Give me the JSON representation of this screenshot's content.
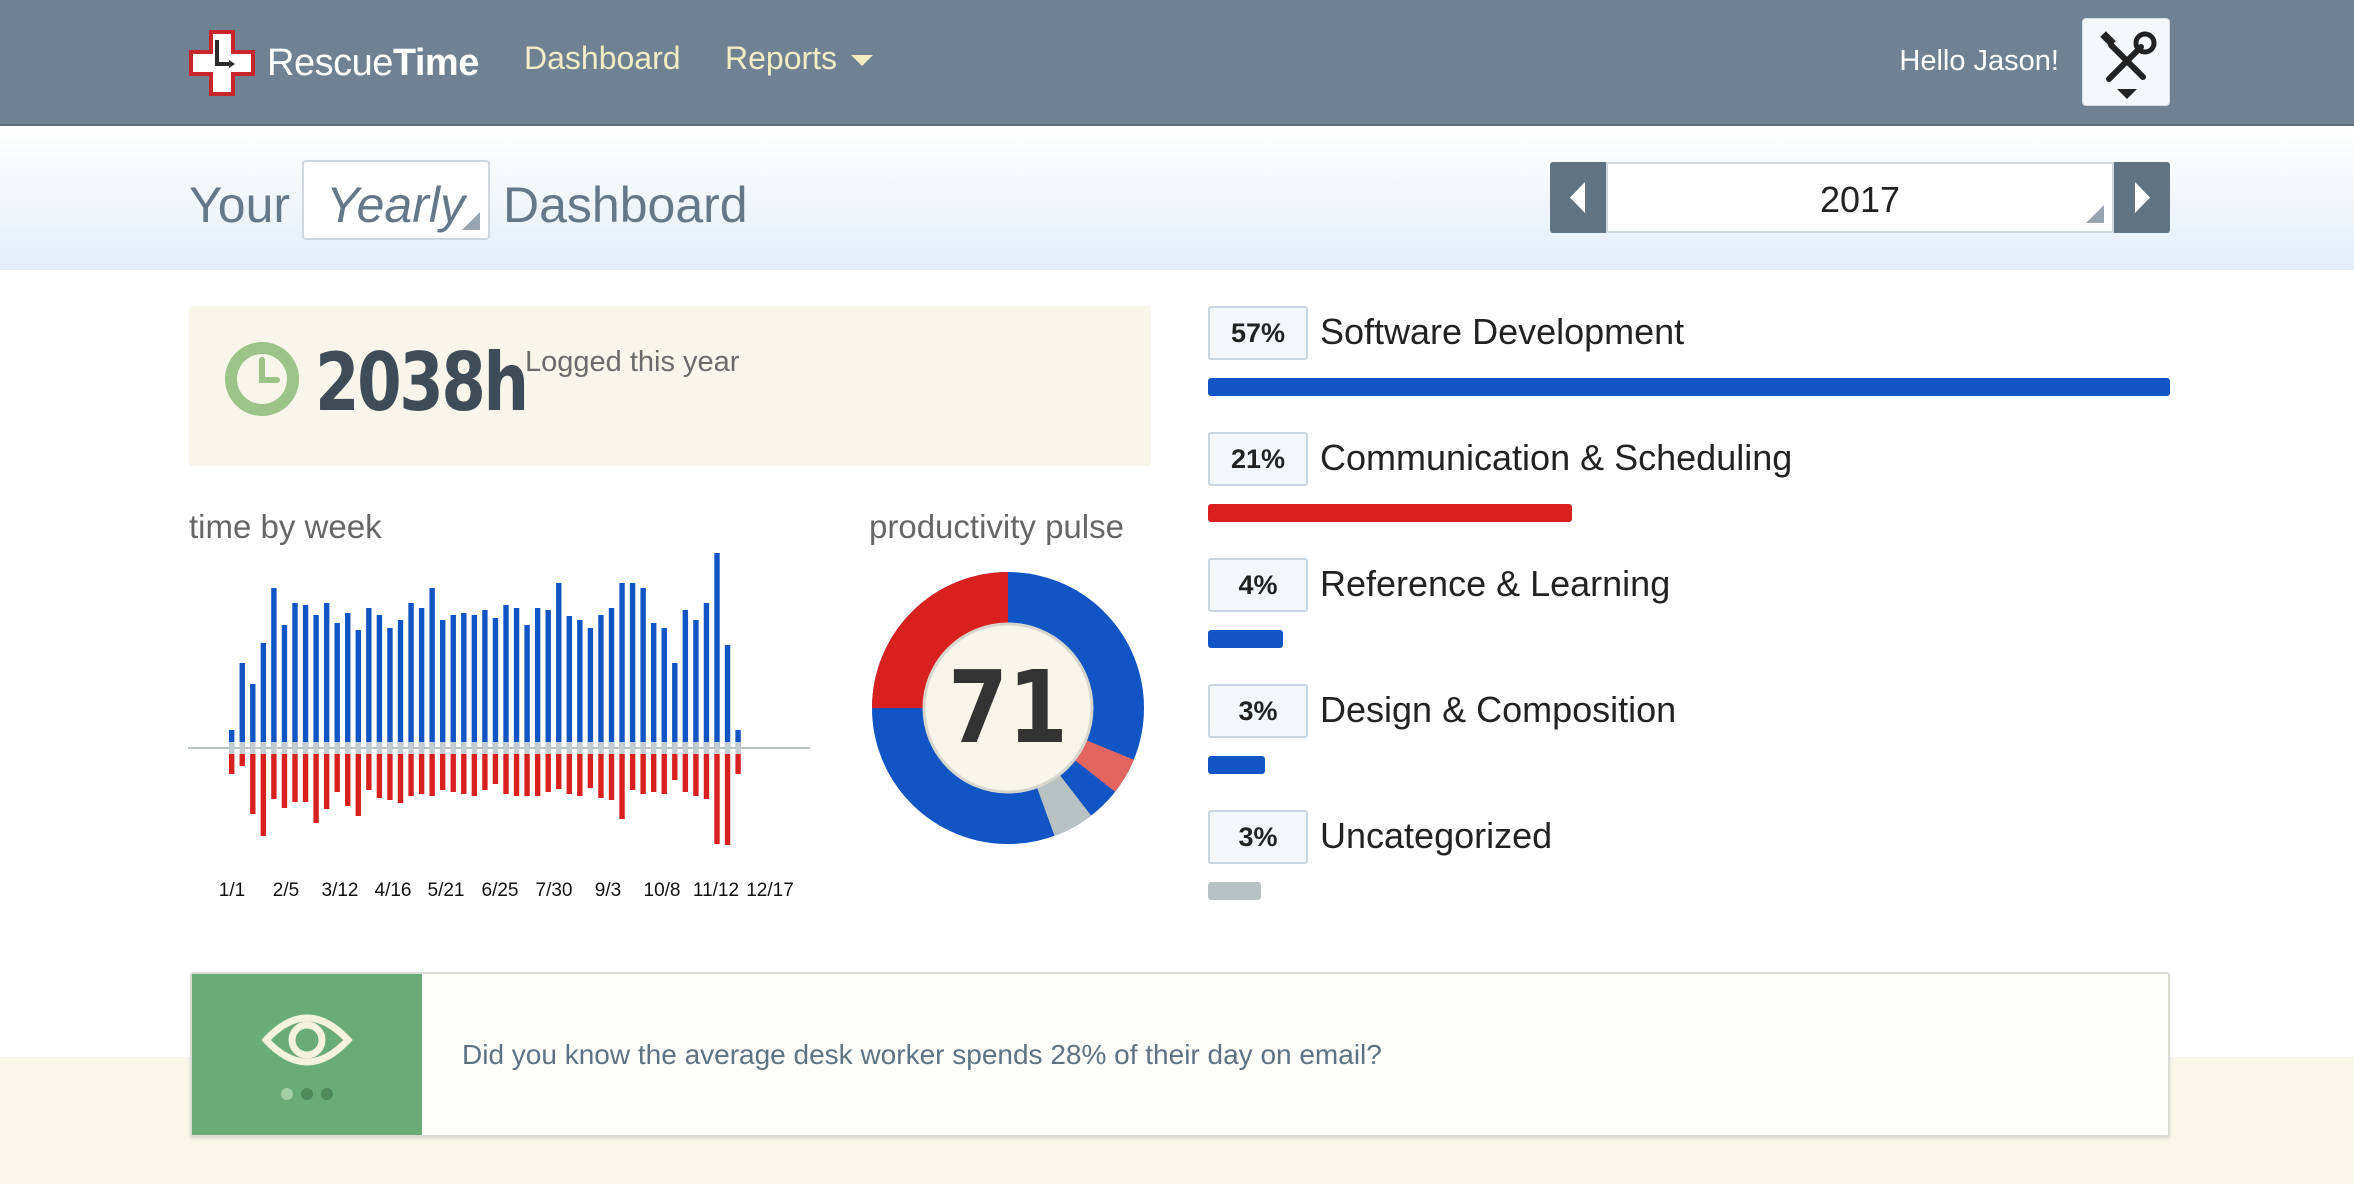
{
  "nav": {
    "logo": {
      "text_light": "Rescue",
      "text_bold": "Time"
    },
    "dashboard_label": "Dashboard",
    "reports_label": "Reports",
    "greeting": "Hello Jason!",
    "settings_icon": "tools-icon"
  },
  "header": {
    "title_prefix": "Your",
    "period": "Yearly",
    "title_suffix": "Dashboard",
    "year": "2017",
    "prev_icon": "chevron-left-icon",
    "next_icon": "chevron-right-icon"
  },
  "summary": {
    "hours": "2038h",
    "hours_label": "Logged this year",
    "icon": "clock-icon"
  },
  "time_by_week": {
    "label": "time by week",
    "tick_labels": [
      "1/1",
      "2/5",
      "3/12",
      "4/16",
      "5/21",
      "6/25",
      "7/30",
      "9/3",
      "10/8",
      "11/12",
      "12/17"
    ]
  },
  "productivity_pulse": {
    "label": "productivity pulse",
    "score": "71"
  },
  "categories": [
    {
      "pct": "57%",
      "name": "Software Development",
      "fraction": 1.0,
      "color": "#1155c4"
    },
    {
      "pct": "21%",
      "name": "Communication & Scheduling",
      "fraction": 0.378,
      "color": "#d8201e"
    },
    {
      "pct": "4%",
      "name": "Reference & Learning",
      "fraction": 0.078,
      "color": "#1155c4"
    },
    {
      "pct": "3%",
      "name": "Design & Composition",
      "fraction": 0.059,
      "color": "#1155c4"
    },
    {
      "pct": "3%",
      "name": "Uncategorized",
      "fraction": 0.055,
      "color": "#b8c2c3"
    }
  ],
  "tip": {
    "text": "Did you know the average desk worker spends 28% of their day on email?",
    "icon": "eye-icon"
  },
  "colors": {
    "nav_bg": "#6e8293",
    "nav_link": "#f4ecc3",
    "productive_blue": "#1155c4",
    "distracting_red": "#d8201e",
    "neutral_grey": "#b8c2c3",
    "tip_green": "#6aac78"
  }
}
